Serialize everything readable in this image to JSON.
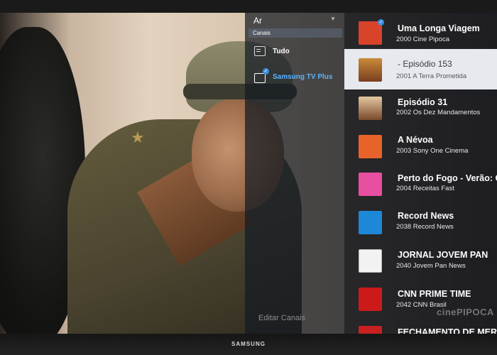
{
  "brand": "SAMSUNG",
  "guide": {
    "source_title": "Ar",
    "group_header": "Canais",
    "categories": [
      {
        "label": "Tudo",
        "icon": "list-icon",
        "selected": false
      },
      {
        "label": "Samsung TV Plus",
        "icon": "tv-icon",
        "selected": true
      }
    ],
    "edit_label": "Editar Canais",
    "watermark": "cinePIPOCA"
  },
  "channels": [
    {
      "program": "Uma Longa Viagem",
      "number": "2000",
      "name": "Cine Pipoca",
      "logo": "cine-pipoca-logo",
      "color": "#d9432a"
    },
    {
      "program": "- Episódio 153",
      "number": "2001",
      "name": "A Terra Prometida",
      "logo": "terra-prometida-logo",
      "color": "#b86a2c",
      "selected": true
    },
    {
      "program": "Episódio 31",
      "number": "2002",
      "name": "Os Dez Mandamentos",
      "logo": "dez-mandamentos-logo",
      "color": "#7a4a2a"
    },
    {
      "program": "A Névoa",
      "number": "2003",
      "name": "Sony One Cinema",
      "logo": "sony-one-logo",
      "color": "#e8632a"
    },
    {
      "program": "Perto do Fogo - Verão: Gu",
      "number": "2004",
      "name": "Receitas Fast",
      "logo": "receitas-fast-logo",
      "color": "#e84fa0"
    },
    {
      "program": "Record News",
      "number": "2038",
      "name": "Record News",
      "logo": "record-news-logo",
      "color": "#1e88d8"
    },
    {
      "program": "JORNAL JOVEM PAN",
      "number": "2040",
      "name": "Jovem Pan News",
      "logo": "jovem-pan-logo",
      "color": "#f2f2f2"
    },
    {
      "program": "CNN PRIME TIME",
      "number": "2042",
      "name": "CNN Brasil",
      "logo": "cnn-brasil-logo",
      "color": "#cc1a1a"
    },
    {
      "program": "FECHAMENTO DE MERCA",
      "number": "",
      "name": "",
      "logo": "news-logo",
      "color": "#c82020"
    }
  ]
}
